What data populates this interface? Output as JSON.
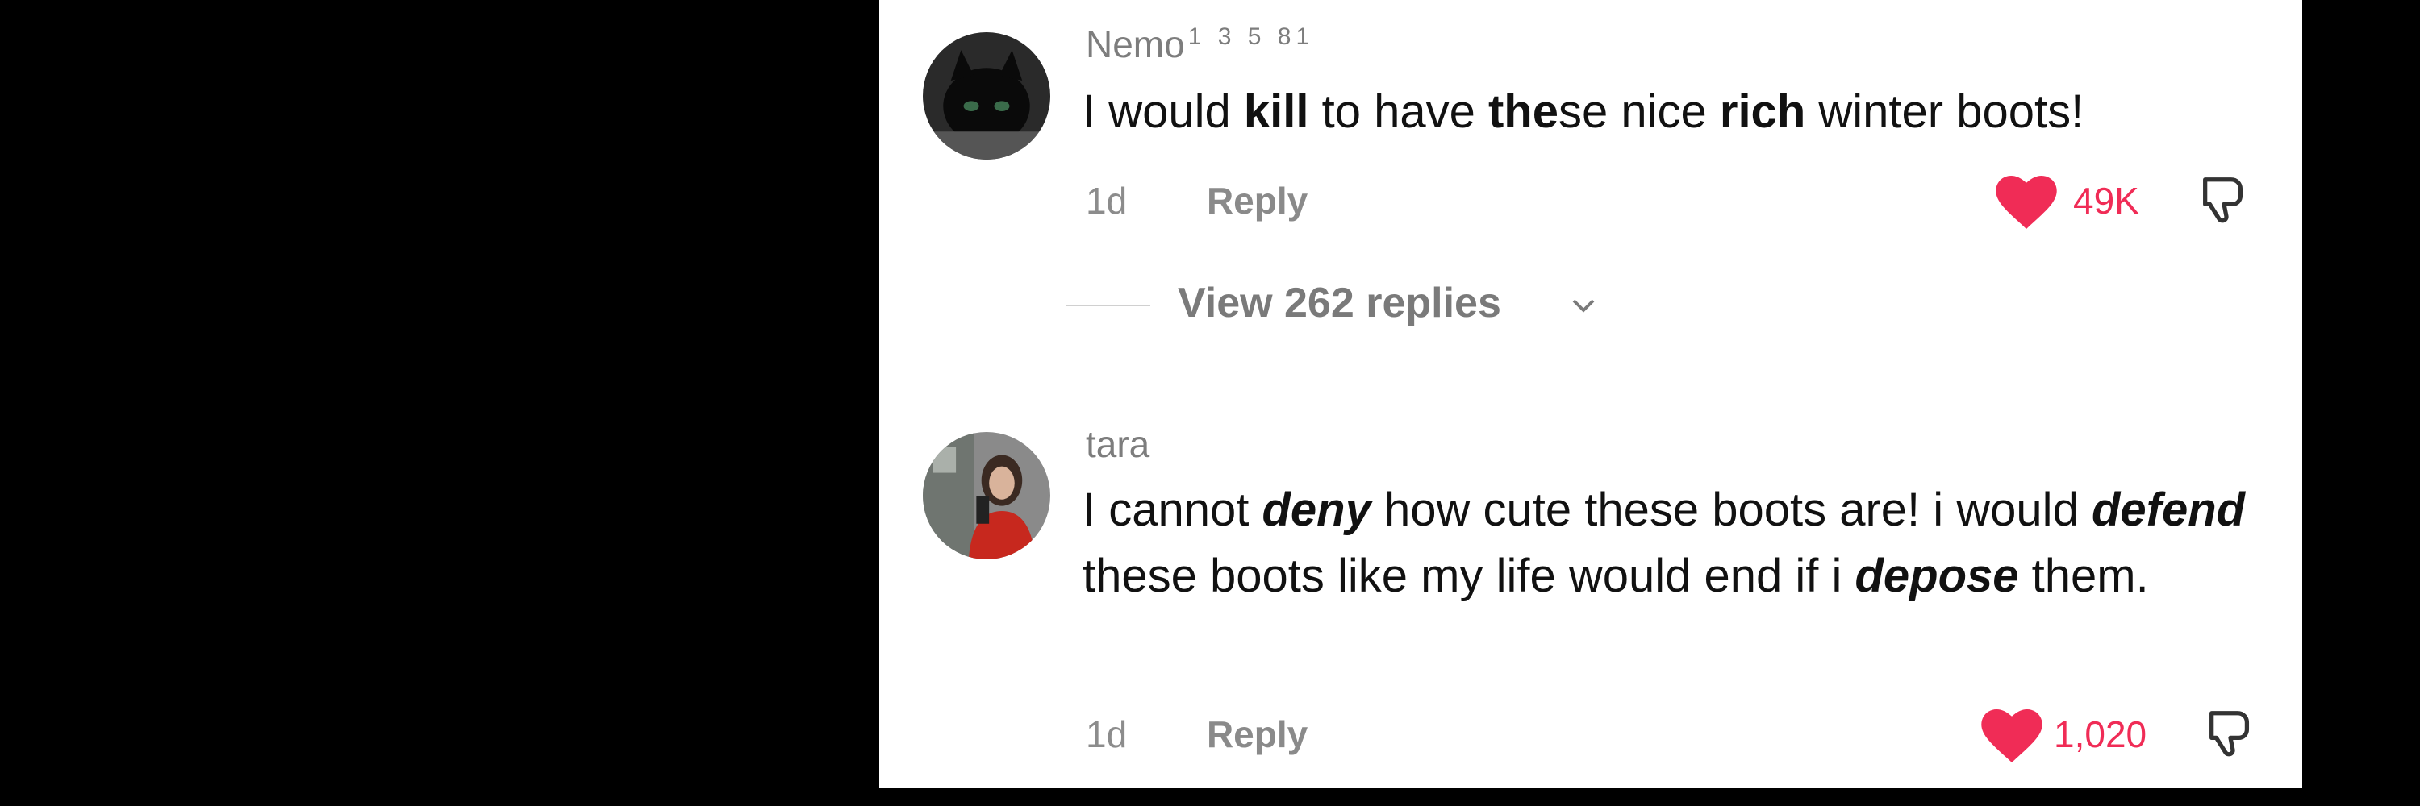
{
  "comments": [
    {
      "username": "Nemo",
      "username_superscript": "1 3 5 81",
      "avatar_icon": "dark-creature-avatar",
      "text_parts": [
        {
          "t": "I would ",
          "style": "normal"
        },
        {
          "t": "kill",
          "style": "bold"
        },
        {
          "t": " to have ",
          "style": "normal"
        },
        {
          "t": "the",
          "style": "bold"
        },
        {
          "t": "se nice ",
          "style": "normal"
        },
        {
          "t": "rich",
          "style": "bold"
        },
        {
          "t": " winter boots!",
          "style": "normal"
        }
      ],
      "age": "1d",
      "reply_label": "Reply",
      "likes": "49K",
      "liked": true,
      "view_replies": "View 262 replies"
    },
    {
      "username": "tara",
      "avatar_icon": "person-photo-avatar",
      "text_parts": [
        {
          "t": "I cannot ",
          "style": "normal"
        },
        {
          "t": "deny",
          "style": "bolditalic"
        },
        {
          "t": " how cute these boots are! i would ",
          "style": "normal"
        },
        {
          "t": "defend",
          "style": "bolditalic"
        },
        {
          "t": " these boots like my life would end if i ",
          "style": "normal"
        },
        {
          "t": "depose",
          "style": "bolditalic"
        },
        {
          "t": " them.",
          "style": "normal"
        }
      ],
      "age": "1d",
      "reply_label": "Reply",
      "likes": "1,020",
      "liked": true
    }
  ],
  "colors": {
    "like_red": "#f02c56",
    "muted_text": "#8c8c8c",
    "background": "#000000",
    "panel": "#ffffff"
  }
}
